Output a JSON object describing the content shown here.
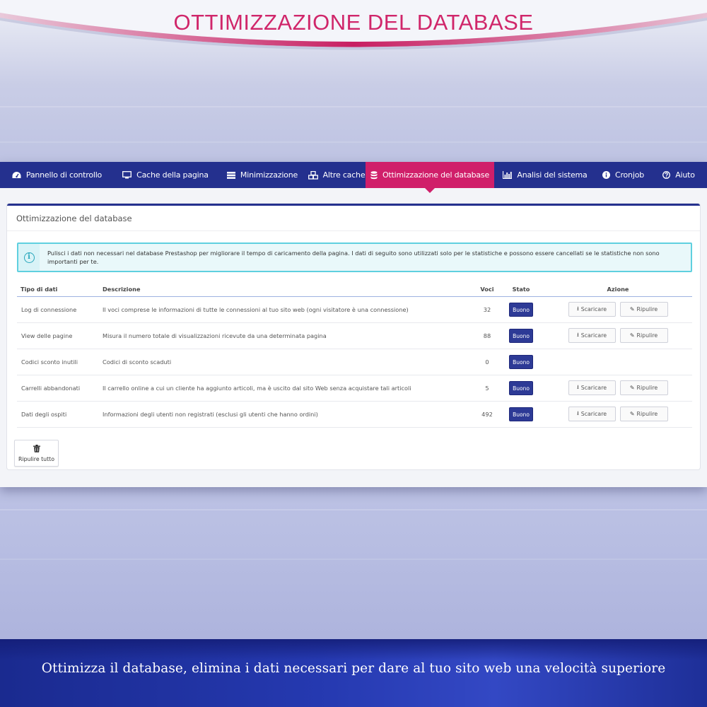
{
  "banner": {
    "title": "OTTIMIZZAZIONE DEL DATABASE"
  },
  "tabs": [
    {
      "label": "Pannello di controllo",
      "icon": "dashboard-icon",
      "active": false
    },
    {
      "label": "Cache della pagina",
      "icon": "monitor-icon",
      "active": false
    },
    {
      "label": "Minimizzazione",
      "icon": "server-icon",
      "active": false
    },
    {
      "label": "Altre cache",
      "icon": "cubes-icon",
      "active": false
    },
    {
      "label": "Ottimizzazione del database",
      "icon": "database-icon",
      "active": true
    },
    {
      "label": "Analisi del sistema",
      "icon": "bar-chart-icon",
      "active": false
    },
    {
      "label": "Cronjob",
      "icon": "info-icon",
      "active": false
    },
    {
      "label": "Aiuto",
      "icon": "help-icon",
      "active": false
    }
  ],
  "panel": {
    "title": "Ottimizzazione del database",
    "info": "Pulisci i dati non necessari nel database Prestashop per migliorare il tempo di caricamento della pagina. I dati di seguito sono utilizzati solo per le statistiche e possono essere cancellati se le statistiche non sono importanti per te.",
    "columns": {
      "type": "Tipo di dati",
      "description": "Descrizione",
      "entries": "Voci",
      "status": "Stato",
      "action": "Azione"
    },
    "rows": [
      {
        "type": "Log di connessione",
        "description": "Il voci comprese le informazioni di tutte le connessioni al tuo sito web (ogni visitatore è una connessione)",
        "entries": "32",
        "status": "Buono",
        "actions": true
      },
      {
        "type": "View delle pagine",
        "description": "Misura il numero totale di visualizzazioni ricevute da una determinata pagina",
        "entries": "88",
        "status": "Buono",
        "actions": true
      },
      {
        "type": "Codici sconto inutili",
        "description": "Codici di sconto scaduti",
        "entries": "0",
        "status": "Buono",
        "actions": false
      },
      {
        "type": "Carrelli abbandonati",
        "description": "Il carrello online a cui un cliente ha aggiunto articoli, ma è uscito dal sito Web senza acquistare tali articoli",
        "entries": "5",
        "status": "Buono",
        "actions": true
      },
      {
        "type": "Dati degli ospiti",
        "description": "Informazioni degli utenti non registrati (esclusi gli utenti che hanno ordini)",
        "entries": "492",
        "status": "Buono",
        "actions": true
      }
    ],
    "download_label": "Scaricare",
    "clean_label": "Ripulire",
    "clear_all_label": "Ripulire tutto"
  },
  "tagline": "Ottimizza il database, elimina i dati necessari per dare al tuo sito web una velocità superiore",
  "colors": {
    "accent": "#d01f6a",
    "navy": "#24308e",
    "info_border": "#5fd0df"
  }
}
